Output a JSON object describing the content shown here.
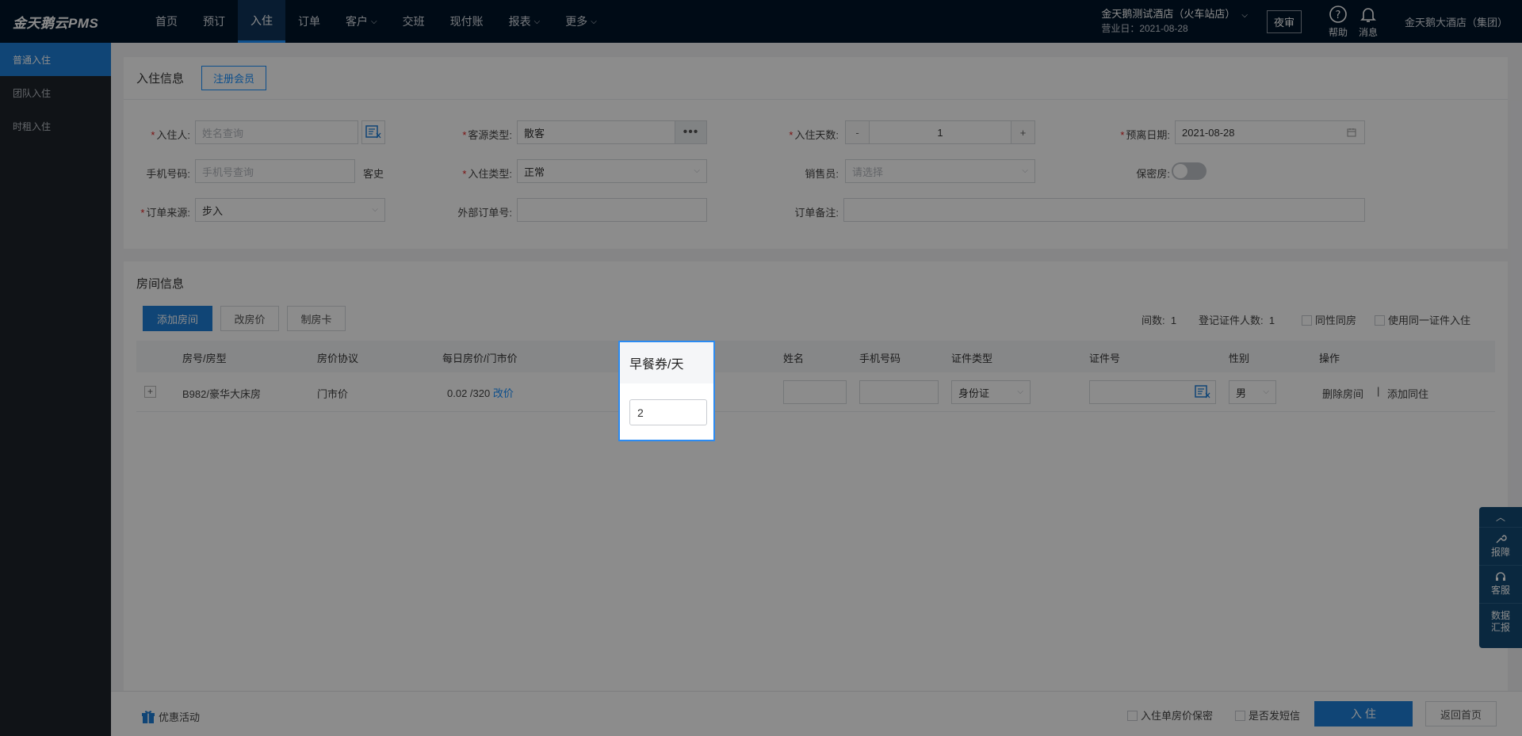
{
  "app": {
    "logo": "金天鹅云PMS"
  },
  "nav": {
    "items": [
      {
        "label": "首页"
      },
      {
        "label": "预订"
      },
      {
        "label": "入住"
      },
      {
        "label": "订单"
      },
      {
        "label": "客户"
      },
      {
        "label": "交班"
      },
      {
        "label": "现付账"
      },
      {
        "label": "报表"
      },
      {
        "label": "更多"
      }
    ],
    "hotel_name": "金天鹅测试酒店（火车站店）",
    "business_date": "营业日：2021-08-28",
    "night_audit": "夜审",
    "help": "帮助",
    "messages": "消息",
    "group_name": "金天鹅大酒店（集团）"
  },
  "sidebar": {
    "items": [
      {
        "label": "普通入住"
      },
      {
        "label": "团队入住"
      },
      {
        "label": "时租入住"
      }
    ]
  },
  "checkin_info": {
    "title": "入住信息",
    "register_member": "注册会员",
    "guest_label": "入住人:",
    "guest_placeholder": "姓名查询",
    "source_label": "客源类型:",
    "source_value": "散客",
    "days_label": "入住天数:",
    "days_value": "1",
    "minus": "-",
    "plus": "+",
    "departure_label": "预离日期:",
    "departure_value": "2021-08-28",
    "phone_label": "手机号码:",
    "phone_placeholder": "手机号查询",
    "history_link": "客史",
    "checkin_type_label": "入住类型:",
    "checkin_type_value": "正常",
    "sales_label": "销售员:",
    "sales_placeholder": "请选择",
    "secret_label": "保密房:",
    "order_source_label": "订单来源:",
    "order_source_value": "步入",
    "external_order_label": "外部订单号:",
    "remark_label": "订单备注:"
  },
  "room_info": {
    "title": "房间信息",
    "add_room": "添加房间",
    "change_price": "改房价",
    "make_card": "制房卡",
    "room_count_label": "间数:",
    "room_count": "1",
    "id_count_label": "登记证件人数:",
    "id_count": "1",
    "same_sex": "同性同房",
    "same_id": "使用同一证件入住",
    "headers": {
      "room": "房号/房型",
      "agreement": "房价协议",
      "price": "每日房价/门市价",
      "name": "姓名",
      "phone": "手机号码",
      "id_type": "证件类型",
      "id_no": "证件号",
      "gender": "性别",
      "ops": "操作"
    },
    "row": {
      "expand": "+",
      "room": "B982/豪华大床房",
      "agreement": "门市价",
      "price": "0.02 /320",
      "change_price": "改价",
      "id_type": "身份证",
      "gender": "男",
      "delete_room": "删除房间",
      "separator": "|",
      "add_cohabitant": "添加同住"
    }
  },
  "float_bar": {
    "report": "报障",
    "service": "客服",
    "data_1": "数据",
    "data_2": "汇报"
  },
  "bottom": {
    "promo": "优惠活动",
    "secret_price": "入住单房价保密",
    "send_sms": "是否发短信",
    "checkin": "入 住",
    "back": "返回首页"
  },
  "popup": {
    "title": "早餐券/天",
    "value": "2"
  }
}
